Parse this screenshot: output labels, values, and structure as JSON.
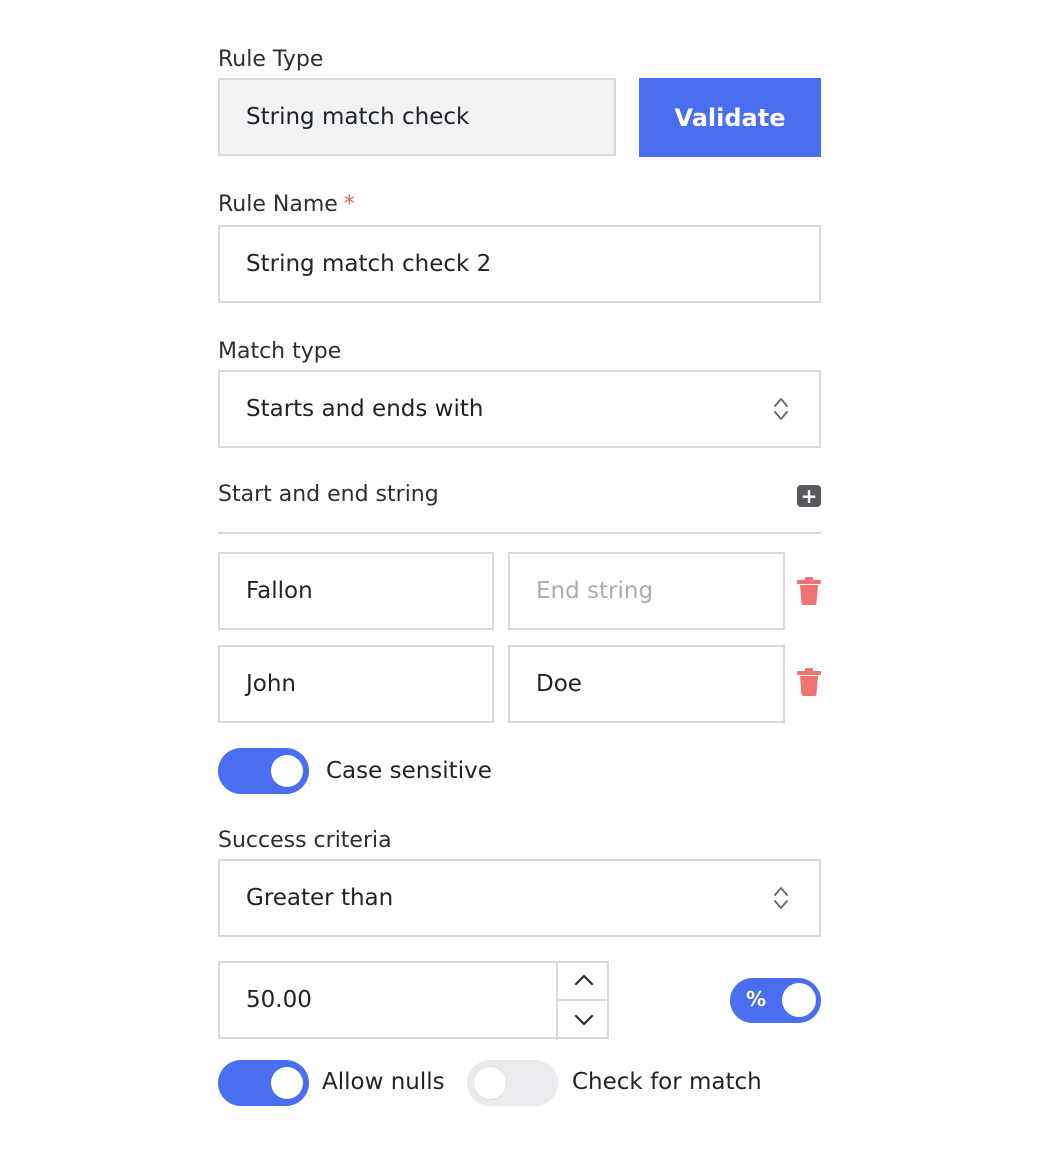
{
  "rule_type": {
    "label": "Rule Type",
    "value": "String match check",
    "validate_label": "Validate"
  },
  "rule_name": {
    "label": "Rule Name",
    "required_marker": "*",
    "value": "String match check 2"
  },
  "match_type": {
    "label": "Match type",
    "value": "Starts and ends with"
  },
  "strings_section": {
    "label": "Start and end string",
    "add_icon": "plus-icon",
    "rows": [
      {
        "start": "Fallon",
        "end": "",
        "end_placeholder": "End string"
      },
      {
        "start": "John",
        "end": "Doe",
        "end_placeholder": "End string"
      }
    ]
  },
  "case_sensitive": {
    "label": "Case sensitive",
    "enabled": true
  },
  "success_criteria": {
    "label": "Success criteria",
    "value": "Greater than"
  },
  "threshold": {
    "value": "50.00",
    "percent_symbol": "%",
    "percent_enabled": true
  },
  "allow_nulls": {
    "label": "Allow nulls",
    "enabled": true
  },
  "check_for_match": {
    "label": "Check for match",
    "enabled": false
  },
  "colors": {
    "accent": "#4a6ef1",
    "danger": "#f07272",
    "border": "#d6d9dd"
  }
}
